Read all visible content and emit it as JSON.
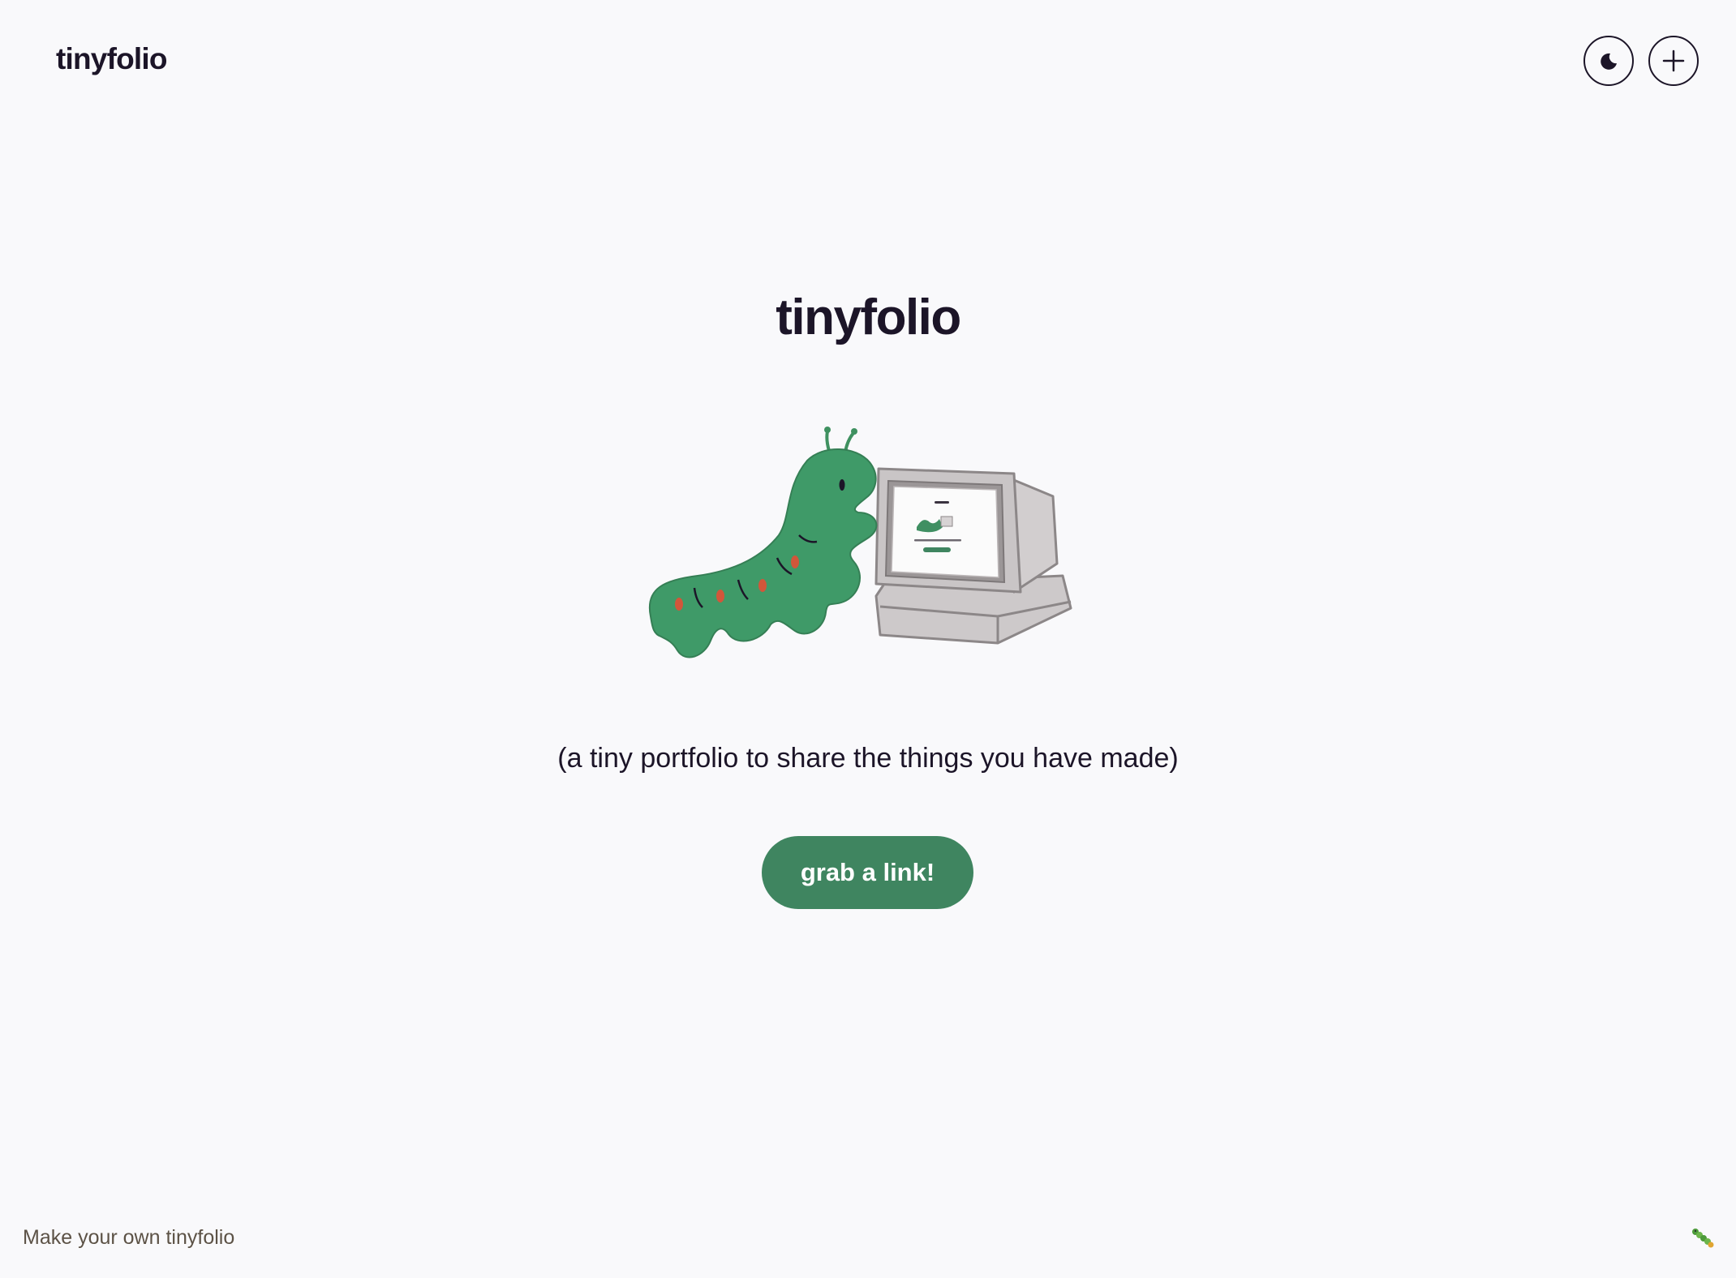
{
  "header": {
    "brand": "tinyfolio",
    "theme_toggle_icon": "moon-icon",
    "add_icon": "plus-icon"
  },
  "hero": {
    "title": "tinyfolio",
    "illustration": "caterpillar-at-computer-illustration",
    "tagline": "(a tiny portfolio to share the things you have made)",
    "cta_label": "grab a link!"
  },
  "footer": {
    "link": "Make your own tinyfolio",
    "icon": "caterpillar-icon"
  },
  "colors": {
    "background": "#f9f9fb",
    "text": "#1c1528",
    "accent": "#3f8560",
    "footer_text": "#5c5246"
  }
}
